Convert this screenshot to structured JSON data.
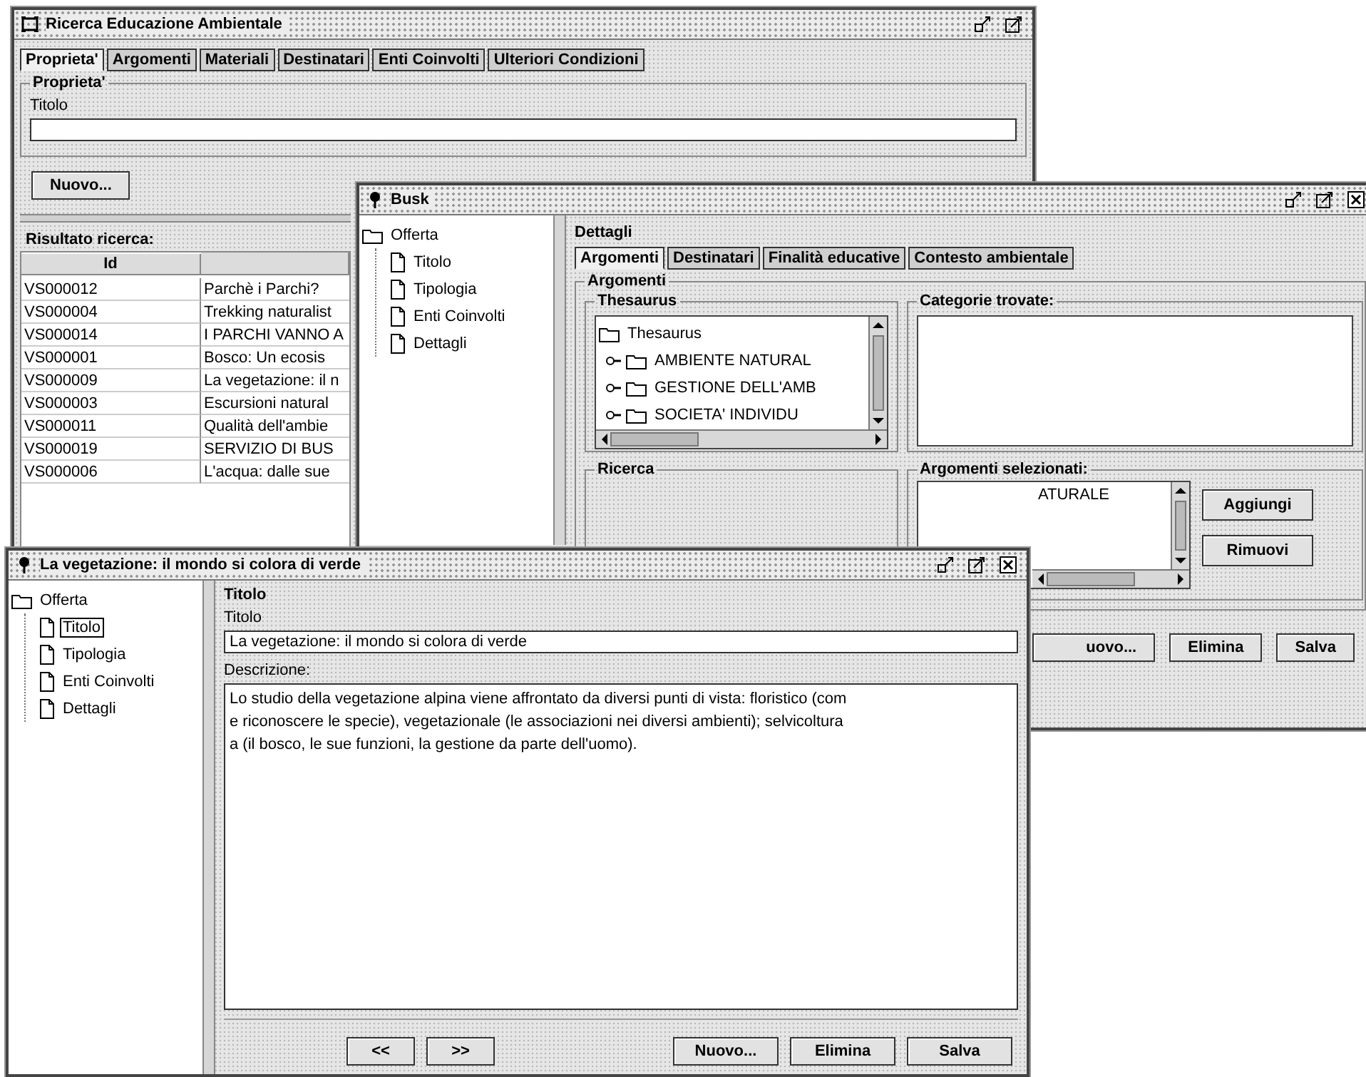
{
  "search_window": {
    "title": "Ricerca Educazione Ambientale",
    "tabs": [
      {
        "label": "Proprieta'",
        "selected": true
      },
      {
        "label": "Argomenti",
        "selected": false
      },
      {
        "label": "Materiali",
        "selected": false
      },
      {
        "label": "Destinatari",
        "selected": false
      },
      {
        "label": "Enti Coinvolti",
        "selected": false
      },
      {
        "label": "Ulteriori Condizioni",
        "selected": false
      }
    ],
    "section": "Proprieta'",
    "field_label": "Titolo",
    "new_button": "Nuovo...",
    "results_label": "Risultato ricerca:",
    "table": {
      "columns": [
        "Id"
      ],
      "rows": [
        [
          "VS000012",
          "Parchè i Parchi?"
        ],
        [
          "VS000004",
          "Trekking naturalist"
        ],
        [
          "VS000014",
          "I PARCHI VANNO A"
        ],
        [
          "VS000001",
          "Bosco: Un ecosis"
        ],
        [
          "VS000009",
          "La vegetazione: il n"
        ],
        [
          "VS000003",
          "Escursioni natural"
        ],
        [
          "VS000011",
          "Qualità dell'ambie"
        ],
        [
          "VS000019",
          "SERVIZIO DI BUS"
        ],
        [
          "VS000006",
          "L'acqua: dalle sue"
        ]
      ]
    }
  },
  "busk_window": {
    "title": "Busk",
    "tree": {
      "label": "Offerta",
      "children": [
        {
          "label": "Titolo",
          "selected": false
        },
        {
          "label": "Tipologia",
          "selected": false
        },
        {
          "label": "Enti Coinvolti",
          "selected": false
        },
        {
          "label": "Dettagli",
          "selected": false
        }
      ]
    },
    "panel_title": "Dettagli",
    "tabs": [
      {
        "label": "Argomenti",
        "selected": true
      },
      {
        "label": "Destinatari",
        "selected": false
      },
      {
        "label": "Finalità educative",
        "selected": false
      },
      {
        "label": "Contesto ambientale",
        "selected": false
      }
    ],
    "section": "Argomenti",
    "thesaurus": {
      "title": "Thesaurus",
      "root": "Thesaurus",
      "items": [
        "AMBIENTE NATURAL",
        "GESTIONE DELL'AMB",
        "SOCIETA' INDIVIDU"
      ]
    },
    "found_title": "Categorie trovate:",
    "search_title": "Ricerca",
    "selected_topics": {
      "title": "Argomenti selezionati:",
      "items": [
        "ATURALE"
      ]
    },
    "side_buttons": [
      "Aggiungi",
      "Rimuovi"
    ],
    "buttons": [
      "uovo...",
      "Elimina",
      "Salva"
    ]
  },
  "detail_window": {
    "title": "La vegetazione: il mondo si colora di verde",
    "tree": {
      "label": "Offerta",
      "children": [
        {
          "label": "Titolo",
          "selected": true
        },
        {
          "label": "Tipologia",
          "selected": false
        },
        {
          "label": "Enti Coinvolti",
          "selected": false
        },
        {
          "label": "Dettagli",
          "selected": false
        }
      ]
    },
    "section": "Titolo",
    "title_label": "Titolo",
    "title_value": "La vegetazione: il mondo si colora di verde",
    "description_label": "Descrizione:",
    "description": "Lo studio della vegetazione alpina viene affrontato da diversi punti di vista: floristico (com\ne riconoscere le specie), vegetazionale (le associazioni nei diversi ambienti); selvicoltura\na (il bosco, le sue funzioni, la gestione da parte dell'uomo).",
    "nav_buttons": [
      "<<",
      ">>"
    ],
    "buttons": [
      "Nuovo...",
      "Elimina",
      "Salva"
    ]
  }
}
